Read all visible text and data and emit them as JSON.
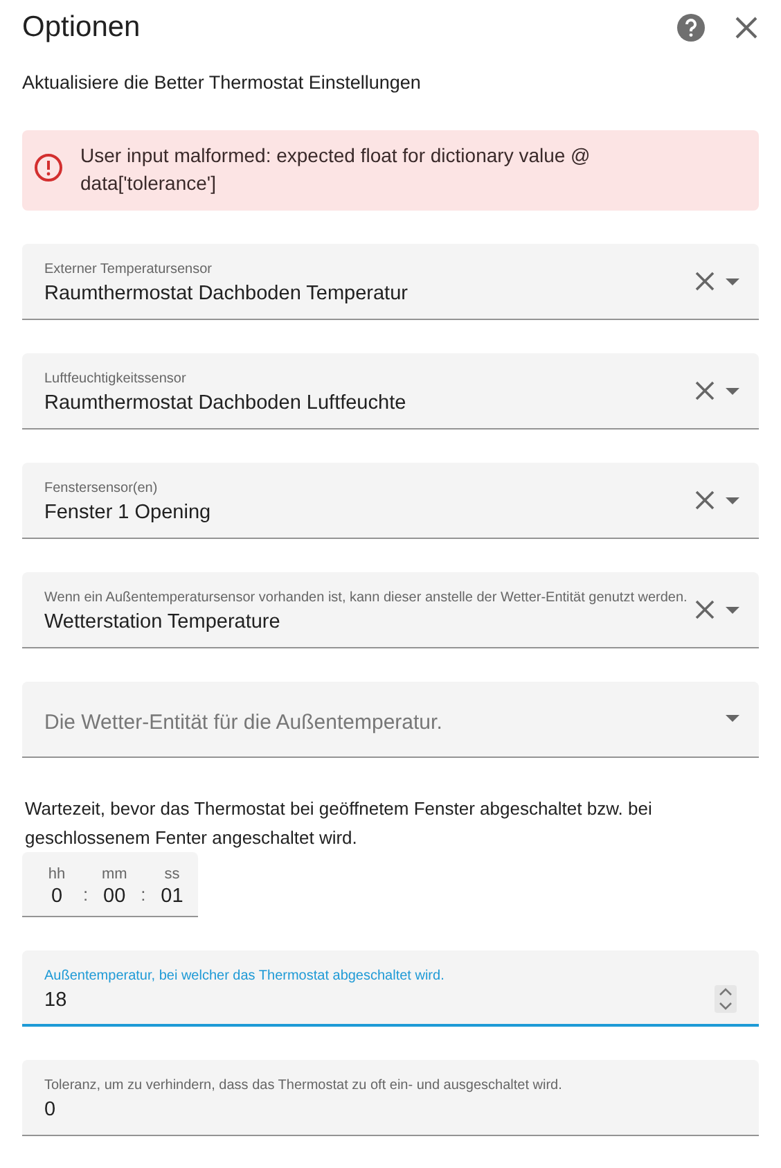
{
  "dialog": {
    "title": "Optionen",
    "subtitle": "Aktualisiere die Better Thermostat Einstellungen"
  },
  "error": {
    "message": "User input malformed: expected float for dictionary value @ data['tolerance']"
  },
  "fields": [
    {
      "kind": "select",
      "label": "Externer Temperatursensor",
      "value": "Raumthermostat Dachboden Temperatur",
      "clearable": true
    },
    {
      "kind": "select",
      "label": "Luftfeuchtigkeitssensor",
      "value": "Raumthermostat Dachboden Luftfeuchte",
      "clearable": true
    },
    {
      "kind": "select",
      "label": "Fenstersensor(en)",
      "value": "Fenster 1 Opening",
      "clearable": true
    },
    {
      "kind": "select",
      "label": "Wenn ein Außentemperatursensor vorhanden ist, kann dieser anstelle der Wetter-Entität genutzt werden.",
      "value": "Wetterstation Temperature",
      "clearable": true
    },
    {
      "kind": "select",
      "placeholder": "Die Wetter-Entität für die Außentemperatur.",
      "clearable": false
    },
    {
      "kind": "time",
      "description": "Wartezeit, bevor das Thermostat bei geöffnetem Fenster abgeschaltet bzw. bei geschlossenem Fenter angeschaltet wird.",
      "units": [
        {
          "label": "hh",
          "value": "0"
        },
        {
          "label": "mm",
          "value": "00"
        },
        {
          "label": "ss",
          "value": "01"
        }
      ],
      "separators": [
        ":",
        ":"
      ]
    },
    {
      "kind": "number",
      "label": "Außentemperatur, bei welcher das Thermostat abgeschaltet wird.",
      "value": "18",
      "focused": true
    },
    {
      "kind": "number",
      "label": "Toleranz, um zu verhindern, dass das Thermostat zu oft ein- und ausgeschaltet wird.",
      "value": "0",
      "focused": false
    }
  ]
}
